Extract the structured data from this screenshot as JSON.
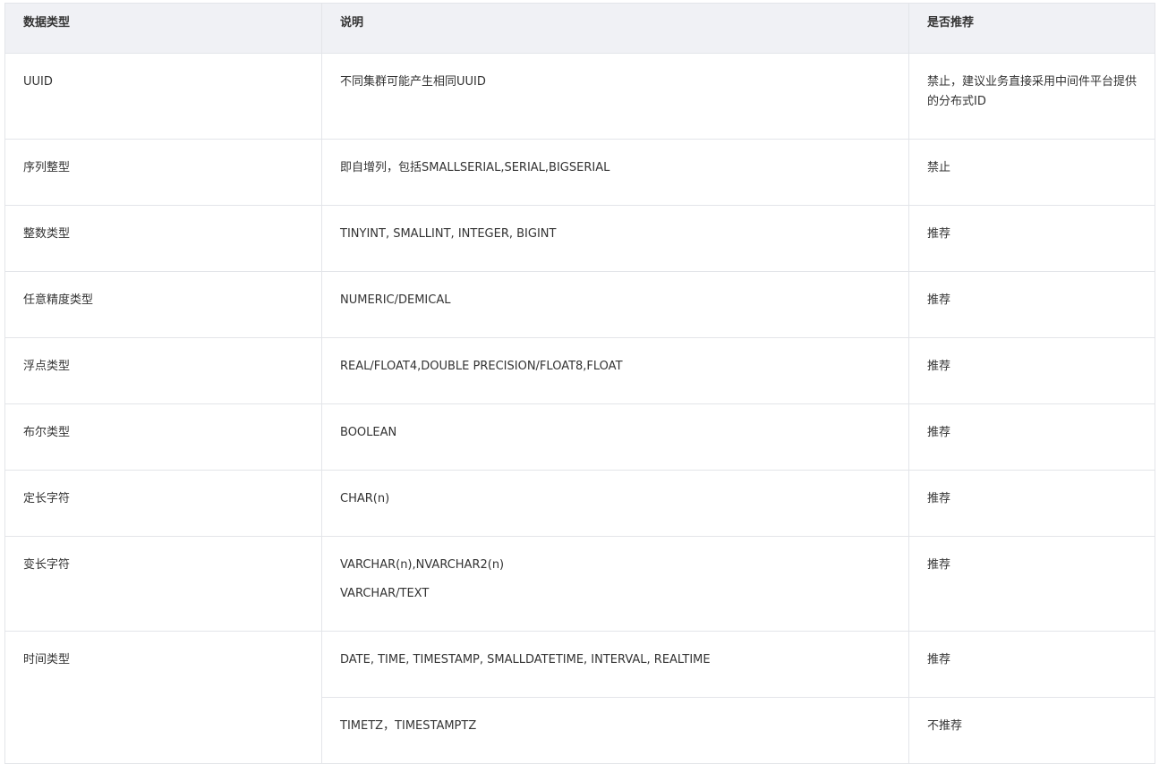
{
  "table": {
    "headers": [
      "数据类型",
      "说明",
      "是否推荐"
    ],
    "rows": [
      {
        "type": "UUID",
        "desc": [
          "不同集群可能产生相同UUID"
        ],
        "rec": "禁止，建议业务直接采用中间件平台提供的分布式ID"
      },
      {
        "type": "序列整型",
        "desc": [
          "即自增列，包括SMALLSERIAL,SERIAL,BIGSERIAL"
        ],
        "rec": "禁止"
      },
      {
        "type": "整数类型",
        "desc": [
          "TINYINT, SMALLINT, INTEGER, BIGINT"
        ],
        "rec": "推荐"
      },
      {
        "type": "任意精度类型",
        "desc": [
          "NUMERIC/DEMICAL"
        ],
        "rec": "推荐"
      },
      {
        "type": "浮点类型",
        "desc": [
          "REAL/FLOAT4,DOUBLE PRECISION/FLOAT8,FLOAT"
        ],
        "rec": "推荐"
      },
      {
        "type": "布尔类型",
        "desc": [
          "BOOLEAN"
        ],
        "rec": "推荐"
      },
      {
        "type": "定长字符",
        "desc": [
          "CHAR(n)"
        ],
        "rec": "推荐"
      },
      {
        "type": "变长字符",
        "desc": [
          "VARCHAR(n),NVARCHAR2(n)",
          "VARCHAR/TEXT"
        ],
        "rec": "推荐"
      },
      {
        "type": "时间类型",
        "desc": [
          "DATE, TIME, TIMESTAMP, SMALLDATETIME, INTERVAL, REALTIME"
        ],
        "rec": "推荐"
      },
      {
        "type": "",
        "desc": [
          "TIMETZ，TIMESTAMPTZ"
        ],
        "rec": "不推荐"
      }
    ]
  }
}
